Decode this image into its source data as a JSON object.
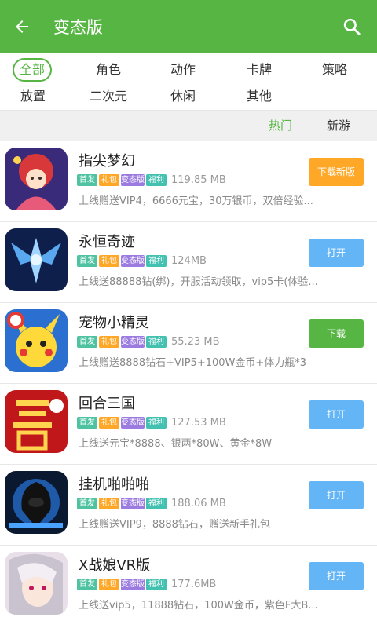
{
  "header": {
    "title": "变态版"
  },
  "categories": [
    {
      "label": "全部",
      "active": true
    },
    {
      "label": "角色",
      "active": false
    },
    {
      "label": "动作",
      "active": false
    },
    {
      "label": "卡牌",
      "active": false
    },
    {
      "label": "策略",
      "active": false
    },
    {
      "label": "放置",
      "active": false
    },
    {
      "label": "二次元",
      "active": false
    },
    {
      "label": "休闲",
      "active": false
    },
    {
      "label": "其他",
      "active": false
    }
  ],
  "sort": {
    "hot": "热门",
    "new": "新游"
  },
  "tags": {
    "t1": "首发",
    "t2": "礼包",
    "t3": "变态版",
    "t4": "福利"
  },
  "colors": {
    "accent": "#57b544",
    "tag1": "#4fc3a1",
    "tag2": "#ffa726",
    "tag3": "#9c7be0",
    "tag4": "#42c0b0",
    "download_new": "#ffa726",
    "open": "#64b5f6",
    "download": "#57b544"
  },
  "games": [
    {
      "name": "指尖梦幻",
      "size": "119.85 MB",
      "desc": "上线赠送VIP4，6666元宝，30万银币，双倍经验...",
      "button": "下载新版",
      "button_type": "download_new"
    },
    {
      "name": "永恒奇迹",
      "size": "124MB",
      "desc": "上线送88888钻(绑)，开服活动领取，vip5卡(体验...",
      "button": "打开",
      "button_type": "open"
    },
    {
      "name": "宠物小精灵",
      "size": "55.23 MB",
      "desc": "上线赠送8888钻石+VIP5+100W金币+体力瓶*3",
      "button": "下载",
      "button_type": "download"
    },
    {
      "name": "回合三国",
      "size": "127.53 MB",
      "desc": "上线送元宝*8888、银两*80W、黄金*8W",
      "button": "打开",
      "button_type": "open"
    },
    {
      "name": "挂机啪啪啪",
      "size": "188.06 MB",
      "desc": "上线赠送VIP9，8888钻石，赠送新手礼包",
      "button": "打开",
      "button_type": "open"
    },
    {
      "name": "X战娘VR版",
      "size": "177.6MB",
      "desc": "上线送vip5，11888钻石，100W金币，紫色F大B...",
      "button": "打开",
      "button_type": "open"
    }
  ]
}
